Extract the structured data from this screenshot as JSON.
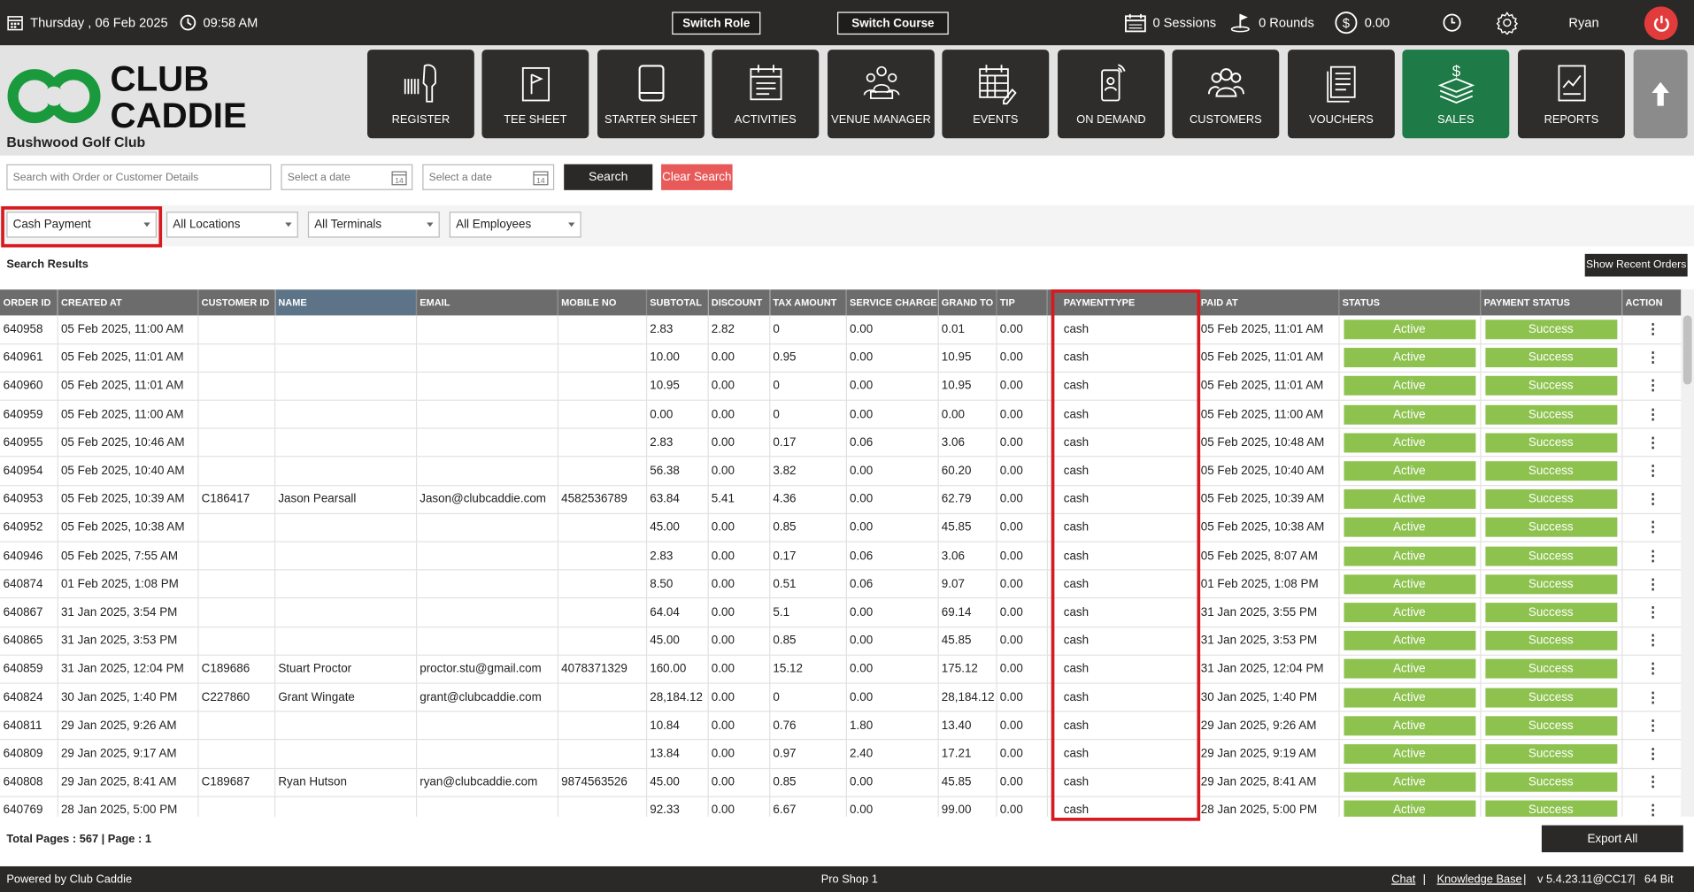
{
  "topbar": {
    "date": "Thursday ,  06 Feb 2025",
    "time": "09:58 AM",
    "switch_role": "Switch Role",
    "switch_course": "Switch Course",
    "sessions": "0 Sessions",
    "rounds": "0 Rounds",
    "balance": "0.00",
    "user": "Ryan"
  },
  "brand": {
    "logo_line1": "CLUB",
    "logo_line2": "CADDIE",
    "club_name": "Bushwood Golf Club",
    "primary_color": "#1e7a47",
    "logo_green": "#1a9a3c"
  },
  "nav": {
    "register": "REGISTER",
    "tee_sheet": "TEE SHEET",
    "starter_sheet": "STARTER SHEET",
    "activities": "ACTIVITIES",
    "venue_manager": "VENUE MANAGER",
    "events": "EVENTS",
    "on_demand": "ON DEMAND",
    "customers": "CUSTOMERS",
    "vouchers": "VOUCHERS",
    "sales": "SALES",
    "reports": "REPORTS",
    "active": "SALES"
  },
  "search": {
    "placeholder": "Search with Order or Customer Details",
    "date_from_placeholder": "Select a date",
    "date_to_placeholder": "Select a date",
    "search_label": "Search",
    "clear_label": "Clear Search"
  },
  "filters": {
    "payment": "Cash Payment",
    "location": "All Locations",
    "terminal": "All Terminals",
    "employee": "All Employees"
  },
  "results": {
    "label": "Search Results",
    "recent_button": "Show Recent Orders"
  },
  "table": {
    "headers": {
      "order_id": "ORDER ID",
      "created_at": "CREATED AT",
      "customer_id": "CUSTOMER ID",
      "name": "NAME",
      "email": "EMAIL",
      "mobile": "MOBILE NO",
      "subtotal": "SUBTOTAL",
      "discount": "DISCOUNT",
      "tax": "TAX AMOUNT",
      "service": "SERVICE CHARGE",
      "grand": "GRAND TO",
      "tip": "TIP",
      "payment_type": "PAYMENTTYPE",
      "paid_at": "PAID AT",
      "status": "STATUS",
      "payment_status": "PAYMENT STATUS",
      "action": "ACTION"
    },
    "rows": [
      [
        "640958",
        "05 Feb 2025, 11:00 AM",
        "",
        "",
        "",
        "",
        "2.83",
        "2.82",
        "0",
        "0.00",
        "0.01",
        "0.00",
        "cash",
        "05 Feb 2025, 11:01 AM",
        "Active",
        "Success"
      ],
      [
        "640961",
        "05 Feb 2025, 11:01 AM",
        "",
        "",
        "",
        "",
        "10.00",
        "0.00",
        "0.95",
        "0.00",
        "10.95",
        "0.00",
        "cash",
        "05 Feb 2025, 11:01 AM",
        "Active",
        "Success"
      ],
      [
        "640960",
        "05 Feb 2025, 11:01 AM",
        "",
        "",
        "",
        "",
        "10.95",
        "0.00",
        "0",
        "0.00",
        "10.95",
        "0.00",
        "cash",
        "05 Feb 2025, 11:01 AM",
        "Active",
        "Success"
      ],
      [
        "640959",
        "05 Feb 2025, 11:00 AM",
        "",
        "",
        "",
        "",
        "0.00",
        "0.00",
        "0",
        "0.00",
        "0.00",
        "0.00",
        "cash",
        "05 Feb 2025, 11:00 AM",
        "Active",
        "Success"
      ],
      [
        "640955",
        "05 Feb 2025, 10:46 AM",
        "",
        "",
        "",
        "",
        "2.83",
        "0.00",
        "0.17",
        "0.06",
        "3.06",
        "0.00",
        "cash",
        "05 Feb 2025, 10:48 AM",
        "Active",
        "Success"
      ],
      [
        "640954",
        "05 Feb 2025, 10:40 AM",
        "",
        "",
        "",
        "",
        "56.38",
        "0.00",
        "3.82",
        "0.00",
        "60.20",
        "0.00",
        "cash",
        "05 Feb 2025, 10:40 AM",
        "Active",
        "Success"
      ],
      [
        "640953",
        "05 Feb 2025, 10:39 AM",
        "C186417",
        "Jason Pearsall",
        "Jason@clubcaddie.com",
        "4582536789",
        "63.84",
        "5.41",
        "4.36",
        "0.00",
        "62.79",
        "0.00",
        "cash",
        "05 Feb 2025, 10:39 AM",
        "Active",
        "Success"
      ],
      [
        "640952",
        "05 Feb 2025, 10:38 AM",
        "",
        "",
        "",
        "",
        "45.00",
        "0.00",
        "0.85",
        "0.00",
        "45.85",
        "0.00",
        "cash",
        "05 Feb 2025, 10:38 AM",
        "Active",
        "Success"
      ],
      [
        "640946",
        "05 Feb 2025, 7:55 AM",
        "",
        "",
        "",
        "",
        "2.83",
        "0.00",
        "0.17",
        "0.06",
        "3.06",
        "0.00",
        "cash",
        "05 Feb 2025, 8:07 AM",
        "Active",
        "Success"
      ],
      [
        "640874",
        "01 Feb 2025, 1:08 PM",
        "",
        "",
        "",
        "",
        "8.50",
        "0.00",
        "0.51",
        "0.06",
        "9.07",
        "0.00",
        "cash",
        "01 Feb 2025, 1:08 PM",
        "Active",
        "Success"
      ],
      [
        "640867",
        "31 Jan 2025, 3:54 PM",
        "",
        "",
        "",
        "",
        "64.04",
        "0.00",
        "5.1",
        "0.00",
        "69.14",
        "0.00",
        "cash",
        "31 Jan 2025, 3:55 PM",
        "Active",
        "Success"
      ],
      [
        "640865",
        "31 Jan 2025, 3:53 PM",
        "",
        "",
        "",
        "",
        "45.00",
        "0.00",
        "0.85",
        "0.00",
        "45.85",
        "0.00",
        "cash",
        "31 Jan 2025, 3:53 PM",
        "Active",
        "Success"
      ],
      [
        "640859",
        "31 Jan 2025, 12:04 PM",
        "C189686",
        "Stuart Proctor",
        "proctor.stu@gmail.com",
        "4078371329",
        "160.00",
        "0.00",
        "15.12",
        "0.00",
        "175.12",
        "0.00",
        "cash",
        "31 Jan 2025, 12:04 PM",
        "Active",
        "Success"
      ],
      [
        "640824",
        "30 Jan 2025, 1:40 PM",
        "C227860",
        "Grant Wingate",
        "grant@clubcaddie.com",
        "",
        "28,184.12",
        "0.00",
        "0",
        "0.00",
        "28,184.12",
        "0.00",
        "cash",
        "30 Jan 2025, 1:40 PM",
        "Active",
        "Success"
      ],
      [
        "640811",
        "29 Jan 2025, 9:26 AM",
        "",
        "",
        "",
        "",
        "10.84",
        "0.00",
        "0.76",
        "1.80",
        "13.40",
        "0.00",
        "cash",
        "29 Jan 2025, 9:26 AM",
        "Active",
        "Success"
      ],
      [
        "640809",
        "29 Jan 2025, 9:17 AM",
        "",
        "",
        "",
        "",
        "13.84",
        "0.00",
        "0.97",
        "2.40",
        "17.21",
        "0.00",
        "cash",
        "29 Jan 2025, 9:19 AM",
        "Active",
        "Success"
      ],
      [
        "640808",
        "29 Jan 2025, 8:41 AM",
        "C189687",
        "Ryan Hutson",
        "ryan@clubcaddie.com",
        "9874563526",
        "45.00",
        "0.00",
        "0.85",
        "0.00",
        "45.85",
        "0.00",
        "cash",
        "29 Jan 2025, 8:41 AM",
        "Active",
        "Success"
      ],
      [
        "640769",
        "28 Jan 2025, 5:00 PM",
        "",
        "",
        "",
        "",
        "92.33",
        "0.00",
        "6.67",
        "0.00",
        "99.00",
        "0.00",
        "cash",
        "28 Jan 2025, 5:00 PM",
        "Active",
        "Success"
      ]
    ]
  },
  "pagination": {
    "text": "Total Pages : 567 | Page : 1",
    "export_label": "Export All"
  },
  "footer": {
    "powered": "Powered by Club Caddie",
    "shop": "Pro Shop 1",
    "chat": "Chat",
    "sep1": "|",
    "kb": "Knowledge Base",
    "sep2": "|",
    "version": "v 5.4.23.11@CC17",
    "sep3": "|",
    "bits": "64 Bit"
  },
  "colors": {
    "topbar": "#2b2927",
    "status_green": "#8dc24f",
    "highlight_red": "#d71920",
    "clear_red": "#e85a5a"
  }
}
